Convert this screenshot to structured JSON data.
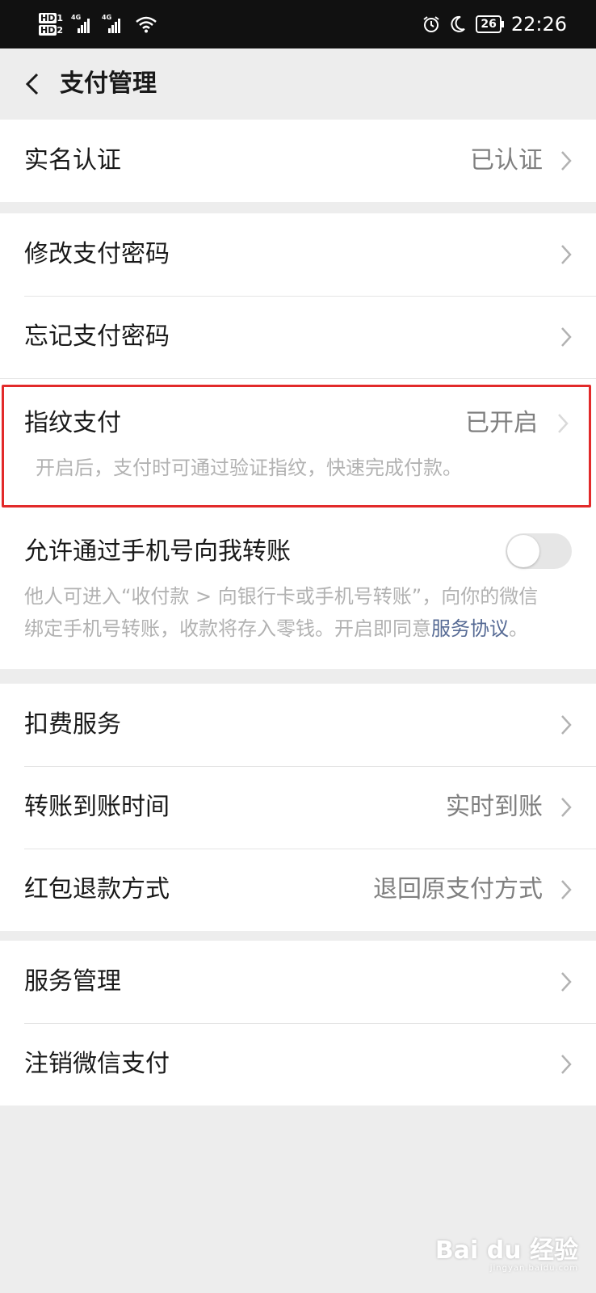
{
  "status_bar": {
    "network_1": "HD",
    "network_2": "HD",
    "sim_1": "1",
    "sim_2": "2",
    "signal_1": "4G",
    "signal_2": "4G",
    "battery": "26",
    "time": "22:26"
  },
  "nav": {
    "title": "支付管理"
  },
  "groups": {
    "realname": {
      "label": "实名认证",
      "value": "已认证"
    },
    "change_pwd": {
      "label": "修改支付密码"
    },
    "forget_pwd": {
      "label": "忘记支付密码"
    },
    "fingerprint": {
      "label": "指纹支付",
      "value": "已开启",
      "desc": "开启后，支付时可通过验证指纹，快速完成付款。"
    },
    "phone_transfer": {
      "label": "允许通过手机号向我转账",
      "enabled": false,
      "desc_line1": "他人可进入“收付款 > 向银行卡或手机号转账”，向你的微信",
      "desc_line2": "绑定手机号转账，收款将存入零钱。开启即同意",
      "link": "服务协议",
      "desc_end": "。"
    },
    "deduction": {
      "label": "扣费服务"
    },
    "transfer_time": {
      "label": "转账到账时间",
      "value": "实时到账"
    },
    "redpacket_refund": {
      "label": "红包退款方式",
      "value": "退回原支付方式"
    },
    "service_mgmt": {
      "label": "服务管理"
    },
    "cancel_pay": {
      "label": "注销微信支付"
    }
  },
  "watermark": {
    "logo": "Bai du 经验",
    "url": "jingyan.baidu.com"
  },
  "colors": {
    "link": "#576b95",
    "highlight_border": "#e22a2a",
    "secondary_text": "#7f7f7f",
    "hint_text": "#b2b2b2"
  }
}
